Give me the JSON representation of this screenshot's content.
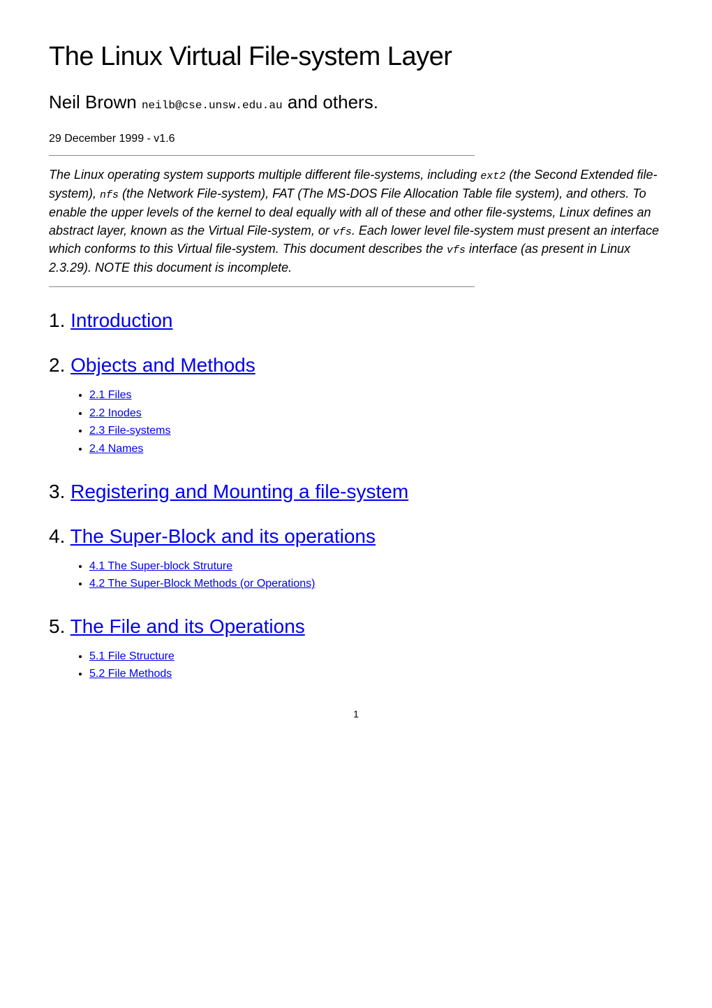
{
  "title": "The Linux Virtual File-system Layer",
  "author": "Neil Brown",
  "email": "neilb@cse.unsw.edu.au",
  "author_suffix": " and others.",
  "date_version": "29 December 1999 - v1.6",
  "abstract": {
    "part1": "The Linux operating system supports multiple different file-systems, including ",
    "term1": "ext2",
    "part2": " (the Second Extended file-system), ",
    "term2": "nfs",
    "part3": " (the Network File-system), FAT (The MS-DOS File Allocation Table file system), and others. To enable the upper levels of the kernel to deal equally with all of these and other file-systems, Linux defines an abstract layer, known as the Virtual File-system, or ",
    "term3": "vfs",
    "part4": ". Each lower level file-system must present an interface which conforms to this Virtual file-system. This document describes the ",
    "term4": "vfs",
    "part5": " interface (as present in Linux 2.3.29). NOTE this document is incomplete."
  },
  "toc": {
    "s1": {
      "num": "1. ",
      "title": "Introduction"
    },
    "s2": {
      "num": "2. ",
      "title": "Objects and Methods",
      "items": [
        "2.1 Files",
        "2.2 Inodes",
        "2.3 File-systems",
        "2.4 Names"
      ]
    },
    "s3": {
      "num": "3. ",
      "title": "Registering and Mounting a file-system"
    },
    "s4": {
      "num": "4. ",
      "title": "The Super-Block and its operations",
      "items": [
        "4.1 The Super-block Struture",
        "4.2 The Super-Block Methods (or Operations)"
      ]
    },
    "s5": {
      "num": "5. ",
      "title": "The File and its Operations",
      "items": [
        "5.1 File Structure",
        "5.2 File Methods"
      ]
    }
  },
  "page_number": "1"
}
